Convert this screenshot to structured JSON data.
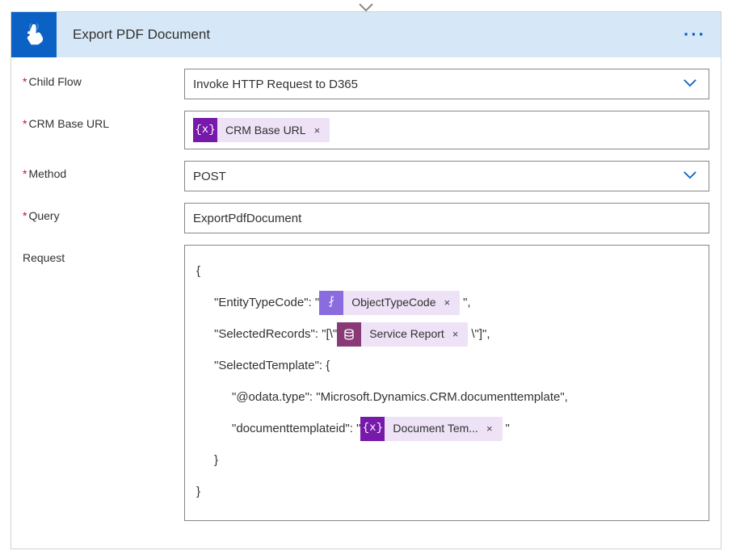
{
  "header": {
    "title": "Export PDF Document"
  },
  "fields": {
    "childFlow": {
      "label": "Child Flow",
      "value": "Invoke HTTP Request to D365"
    },
    "crmBaseUrl": {
      "label": "CRM Base URL",
      "token": "CRM Base URL"
    },
    "method": {
      "label": "Method",
      "value": "POST"
    },
    "query": {
      "label": "Query",
      "value": "ExportPdfDocument"
    },
    "request": {
      "label": "Request"
    }
  },
  "request": {
    "open": "{",
    "l1_pre": "\"EntityTypeCode\": \"",
    "l1_token": "ObjectTypeCode",
    "l1_post": "\",",
    "l2_pre": "\"SelectedRecords\": \"[\\\"",
    "l2_token": "Service Report",
    "l2_post": "\\\"]\",",
    "l3": "\"SelectedTemplate\": {",
    "l4": "\"@odata.type\": \"Microsoft.Dynamics.CRM.documenttemplate\",",
    "l5_pre": "\"documenttemplateid\": \"",
    "l5_token": "Document Tem...",
    "l5_post": "\"",
    "l6": "}",
    "close": "}"
  },
  "glyph": {
    "x": "×",
    "fx": "{x}",
    "expr": "⨏",
    "db": ""
  }
}
